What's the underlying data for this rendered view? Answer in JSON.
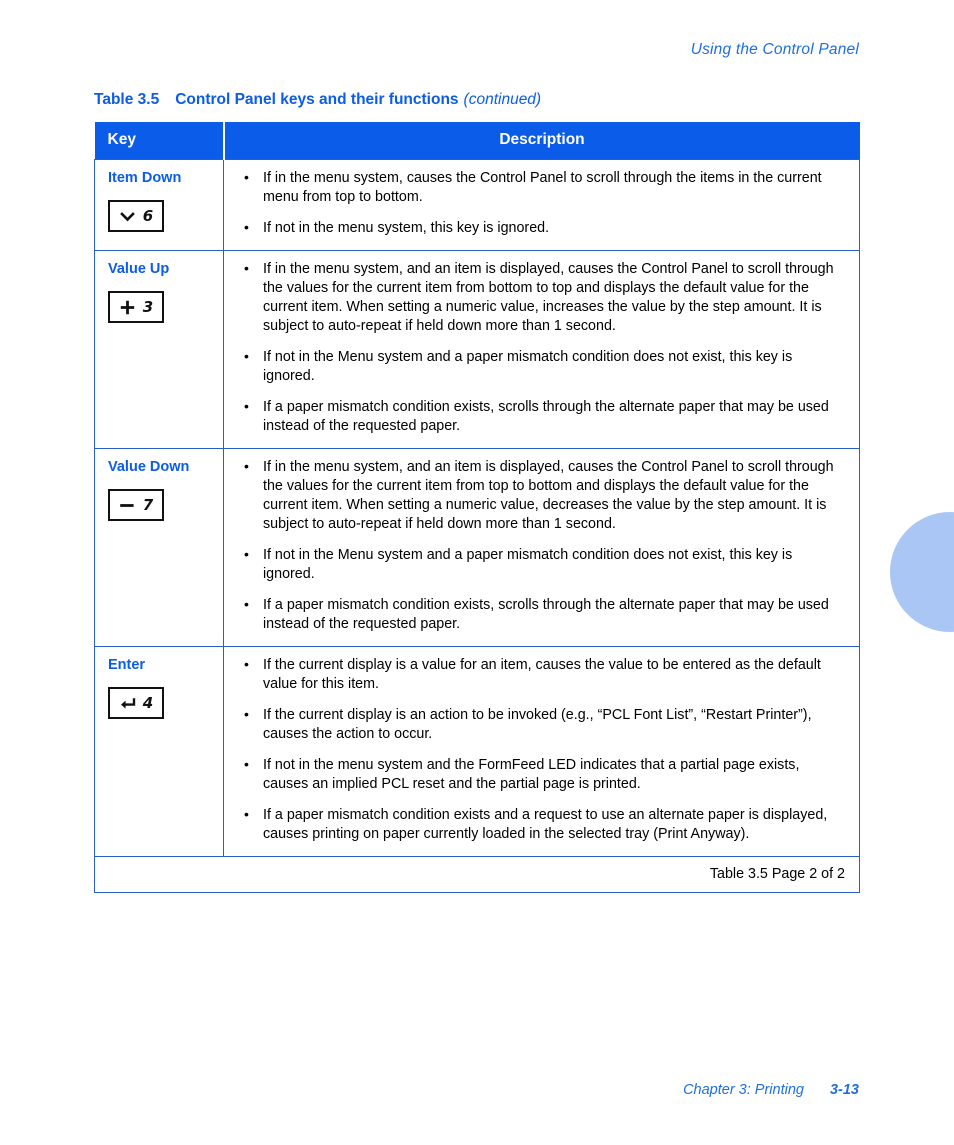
{
  "running_header": "Using the Control Panel",
  "caption": {
    "number": "Table 3.5",
    "title": "Control Panel keys and their functions",
    "continued": "(continued)"
  },
  "table": {
    "columns": {
      "key": "Key",
      "description": "Description"
    },
    "rows": [
      {
        "key_name": "Item Down",
        "key_icon": "chevron-down-icon",
        "key_number": "6",
        "bullets": [
          "If in the menu system, causes the Control Panel to scroll through the items in the current menu from top to bottom.",
          "If not in the menu system, this key is ignored."
        ]
      },
      {
        "key_name": "Value Up",
        "key_icon": "plus-icon",
        "key_number": "3",
        "bullets": [
          "If in the menu system, and an item is displayed, causes the Control Panel to scroll through the values for the current item from bottom to top and displays the default value for the current item. When setting a numeric value, increases the value by the step amount. It is subject to auto-repeat if held down more than 1 second.",
          "If not in the Menu system and a paper mismatch condition does not exist, this key is ignored.",
          "If a paper mismatch condition exists, scrolls through the alternate paper that may be used instead of the requested paper."
        ]
      },
      {
        "key_name": "Value Down",
        "key_icon": "minus-icon",
        "key_number": "7",
        "bullets": [
          "If in the menu system, and an item is displayed, causes the Control Panel to scroll through the values for the current item from top to bottom and displays the default value for the current item. When setting a numeric value, decreases the value by the step amount. It is subject to auto-repeat if held down more than 1 second.",
          "If not in the Menu system and a paper mismatch condition does not exist, this key is ignored.",
          "If a paper mismatch condition exists, scrolls through the alternate paper that may be used instead of the requested paper."
        ]
      },
      {
        "key_name": "Enter",
        "key_icon": "enter-return-icon",
        "key_number": "4",
        "bullets": [
          "If the current display is a value for an item, causes the value to be entered as the default value for this item.",
          "If the current display is an action to be invoked (e.g., “PCL Font List”, “Restart Printer”), causes the action to occur.",
          "If not in the menu system and the FormFeed LED indicates that a partial page exists, causes an implied PCL reset and the partial page is printed.",
          "If a paper mismatch condition exists and a request to use an alternate paper is displayed, causes printing on paper currently loaded in the selected tray (Print Anyway)."
        ]
      }
    ],
    "footer": "Table 3.5  Page 2 of 2"
  },
  "page_footer": {
    "chapter": "Chapter 3: Printing",
    "folio": "3-13"
  },
  "colors": {
    "accent_blue": "#0b5ce8",
    "header_blue": "#1f6fe0",
    "border_blue": "#2a5fc9",
    "thumb_tab": "#a9c6f5"
  }
}
